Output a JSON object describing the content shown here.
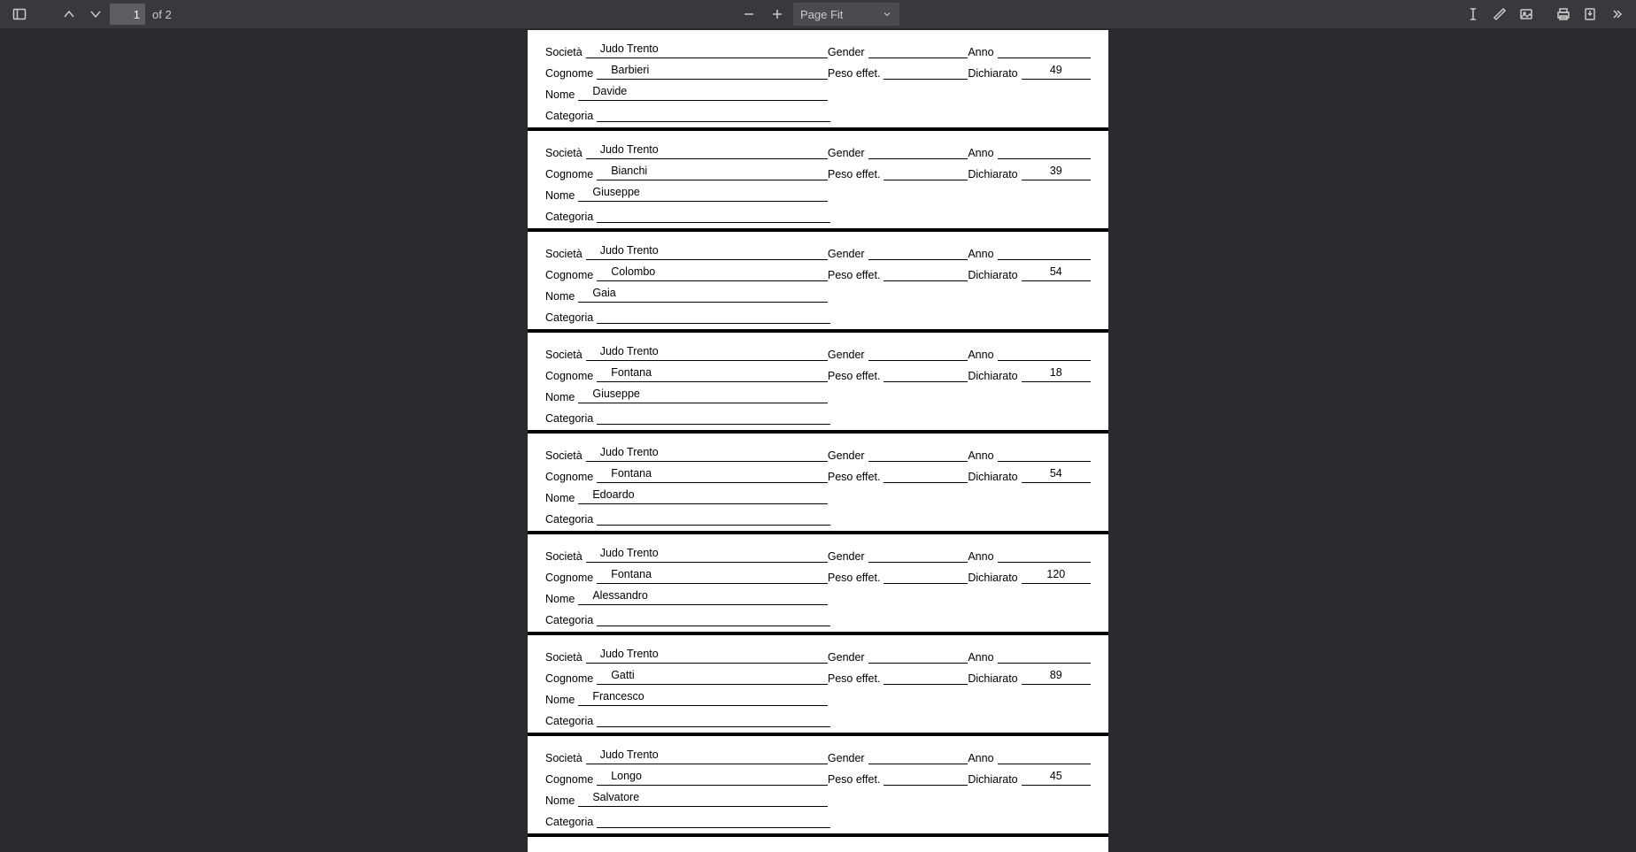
{
  "toolbar": {
    "currentPage": "1",
    "totalPages": "of 2",
    "zoomLabel": "Page Fit"
  },
  "labels": {
    "societa": "Società",
    "cognome": "Cognome",
    "nome": "Nome",
    "categoria": "Categoria",
    "gender": "Gender",
    "peso": "Peso effet.",
    "anno": "Anno",
    "dichiarato": "Dichiarato"
  },
  "records": [
    {
      "societa": "Judo Trento",
      "cognome": "Barbieri",
      "nome": "Davide",
      "dichiarato": "49"
    },
    {
      "societa": "Judo Trento",
      "cognome": "Bianchi",
      "nome": "Giuseppe",
      "dichiarato": "39"
    },
    {
      "societa": "Judo Trento",
      "cognome": "Colombo",
      "nome": "Gaia",
      "dichiarato": "54"
    },
    {
      "societa": "Judo Trento",
      "cognome": "Fontana",
      "nome": "Giuseppe",
      "dichiarato": "18"
    },
    {
      "societa": "Judo Trento",
      "cognome": "Fontana",
      "nome": "Edoardo",
      "dichiarato": "54"
    },
    {
      "societa": "Judo Trento",
      "cognome": "Fontana",
      "nome": "Alessandro",
      "dichiarato": "120"
    },
    {
      "societa": "Judo Trento",
      "cognome": "Gatti",
      "nome": "Francesco",
      "dichiarato": "89"
    },
    {
      "societa": "Judo Trento",
      "cognome": "Longo",
      "nome": "Salvatore",
      "dichiarato": "45"
    }
  ]
}
